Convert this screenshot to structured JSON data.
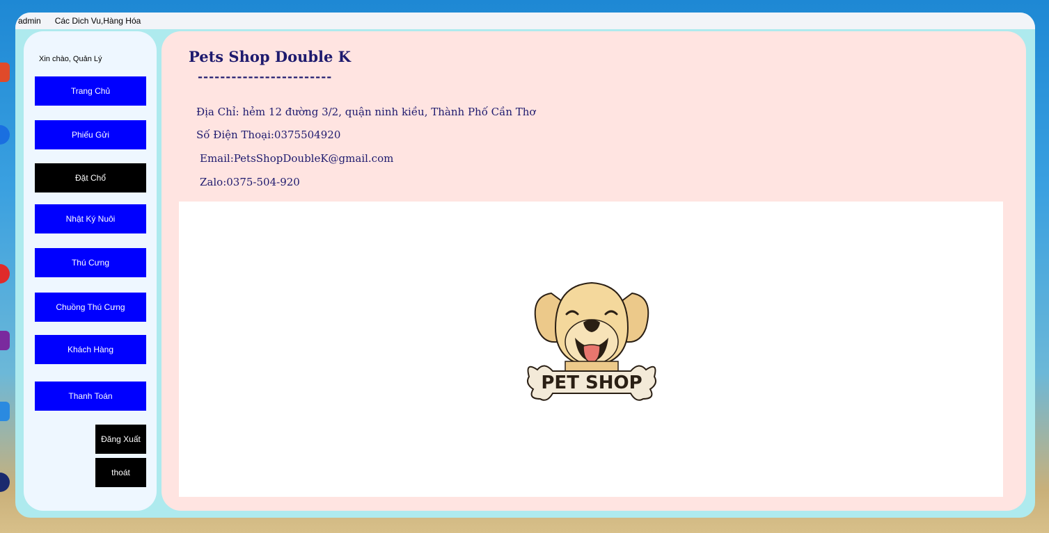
{
  "menu": {
    "items": [
      "admin",
      "Các Dich Vu,Hàng Hóa"
    ]
  },
  "sidebar": {
    "greeting": "Xin chào, Quản Lý",
    "nav": [
      {
        "label": "Trang Chủ"
      },
      {
        "label": "Phiếu Gửi"
      },
      {
        "label": "Đặt Chổ"
      },
      {
        "label": "Nhật Ký Nuôi"
      },
      {
        "label": "Thú Cưng"
      },
      {
        "label": "Chuồng Thú Cưng"
      },
      {
        "label": "Khách Hàng"
      },
      {
        "label": "Thanh Toán"
      }
    ],
    "logout_label": "Đăng Xuất",
    "exit_label": "thoát"
  },
  "main": {
    "title": "Pets Shop Double K",
    "divider": "------------------------",
    "address": "Địa Chỉ: hẻm 12 đường 3/2, quận ninh kiều, Thành Phố Cần Thơ",
    "phone": "Số Điện Thoại:0375504920",
    "email": "Email:PetsShopDoubleK@gmail.com",
    "zalo": "Zalo:0375-504-920",
    "logo_text": "PET SHOP"
  },
  "colors": {
    "nav_button": "#0000ff",
    "nav_active": "#000000",
    "main_bg": "#ffe4e1",
    "sidebar_bg": "#eef7ff",
    "window_bg": "#aeeaee",
    "title_text": "#1e1a6e"
  },
  "icons": [
    "app-icon",
    "dog-logo-icon"
  ]
}
